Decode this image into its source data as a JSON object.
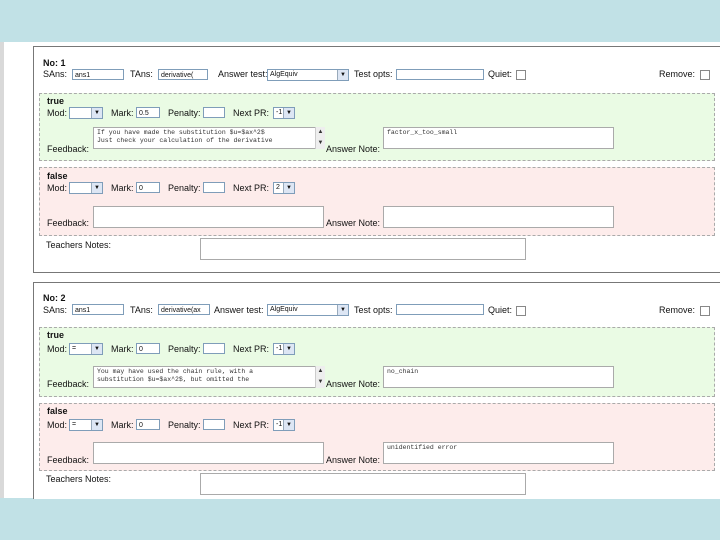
{
  "nodes": [
    {
      "title": "No: 1",
      "sans_label": "SAns:",
      "sans_value": "ans1",
      "tans_label": "TAns:",
      "tans_value": "derivative(",
      "answer_test_label": "Answer test:",
      "answer_test_value": "AlgEquiv",
      "test_opts_label": "Test opts:",
      "test_opts_value": "",
      "quiet_label": "Quiet:",
      "remove_label": "Remove:",
      "true_branch": {
        "label": "true",
        "mod_label": "Mod:",
        "mod_value": "",
        "mark_label": "Mark:",
        "mark_value": "0.5",
        "penalty_label": "Penalty:",
        "penalty_value": "",
        "next_pr_label": "Next PR:",
        "next_pr_value": "-1",
        "feedback_label": "Feedback:",
        "feedback_text": "If you have made the substitution $u=$ax^2$\nJust check your calculation of the derivative",
        "answer_note_label": "Answer Note:",
        "answer_note_value": "factor_x_too_small"
      },
      "false_branch": {
        "label": "false",
        "mod_label": "Mod:",
        "mod_value": "",
        "mark_label": "Mark:",
        "mark_value": "0",
        "penalty_label": "Penalty:",
        "penalty_value": "",
        "next_pr_label": "Next PR:",
        "next_pr_value": "2",
        "feedback_label": "Feedback:",
        "feedback_text": "",
        "answer_note_label": "Answer Note:",
        "answer_note_value": ""
      },
      "teachers_notes_label": "Teachers Notes:",
      "teachers_notes_value": ""
    },
    {
      "title": "No: 2",
      "sans_label": "SAns:",
      "sans_value": "ans1",
      "tans_label": "TAns:",
      "tans_value": "derivative(ax",
      "answer_test_label": "Answer test:",
      "answer_test_value": "AlgEquiv",
      "test_opts_label": "Test opts:",
      "test_opts_value": "",
      "quiet_label": "Quiet:",
      "remove_label": "Remove:",
      "true_branch": {
        "label": "true",
        "mod_label": "Mod:",
        "mod_value": "=",
        "mark_label": "Mark:",
        "mark_value": "0",
        "penalty_label": "Penalty:",
        "penalty_value": "",
        "next_pr_label": "Next PR:",
        "next_pr_value": "-1",
        "feedback_label": "Feedback:",
        "feedback_text": "You may have used the chain rule, with a\nsubstitution $u=$ax^2$, but omitted the",
        "answer_note_label": "Answer Note:",
        "answer_note_value": "no_chain"
      },
      "false_branch": {
        "label": "false",
        "mod_label": "Mod:",
        "mod_value": "=",
        "mark_label": "Mark:",
        "mark_value": "0",
        "penalty_label": "Penalty:",
        "penalty_value": "",
        "next_pr_label": "Next PR:",
        "next_pr_value": "-1",
        "feedback_label": "Feedback:",
        "feedback_text": "",
        "answer_note_label": "Answer Note:",
        "answer_note_value": "unidentified error"
      },
      "teachers_notes_label": "Teachers Notes:",
      "teachers_notes_value": ""
    }
  ],
  "colors": {
    "background": "#c1e1e6",
    "true_branch": "#eafbe4",
    "false_branch": "#fdeceb"
  },
  "icons": {
    "dropdown": "chevron-down-icon",
    "scroll_up": "arrow-up-icon",
    "scroll_down": "arrow-down-icon"
  }
}
